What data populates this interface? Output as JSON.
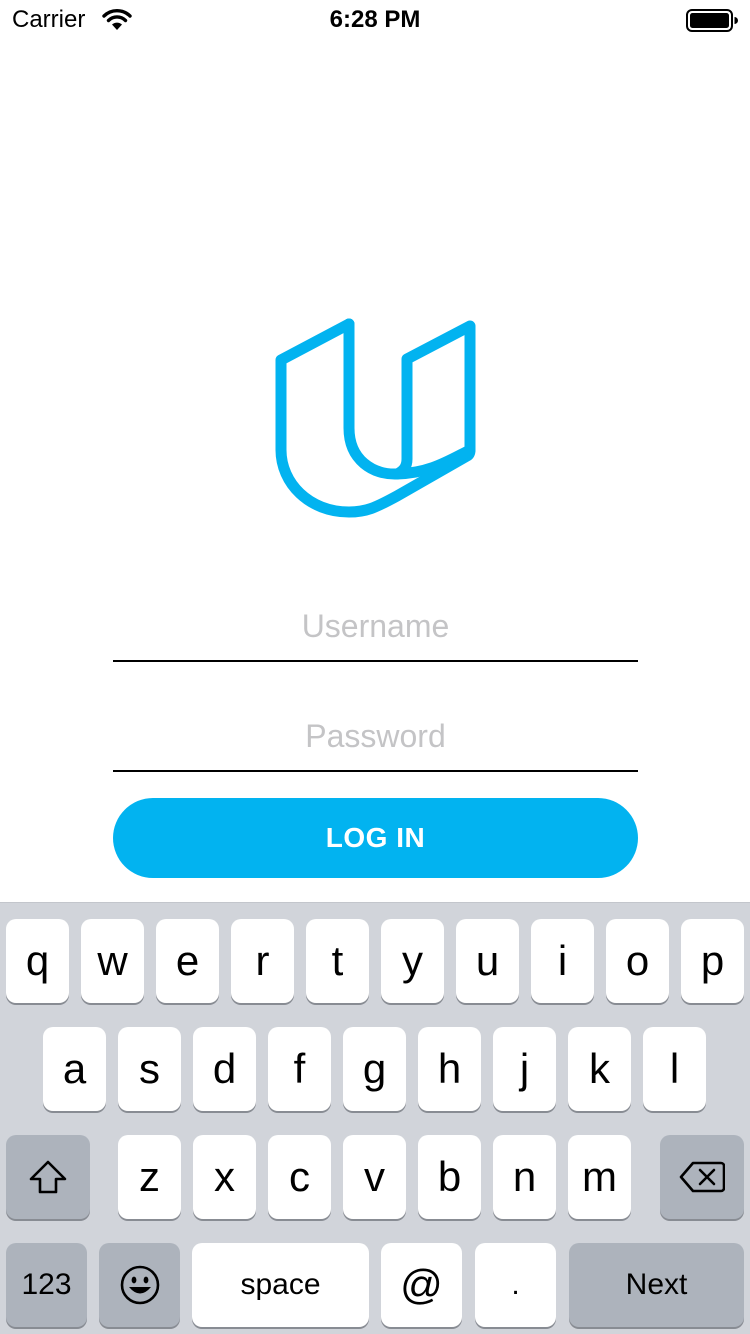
{
  "status_bar": {
    "carrier": "Carrier",
    "time": "6:28 PM",
    "wifi_icon": "wifi-icon",
    "battery_icon": "battery-icon"
  },
  "logo": {
    "icon": "udacity-logo",
    "color": "#02b3f0"
  },
  "form": {
    "username": {
      "value": "",
      "placeholder": "Username"
    },
    "password": {
      "value": "",
      "placeholder": "Password"
    },
    "login_label": "LOG IN",
    "accent_color": "#02b3f0"
  },
  "keyboard": {
    "row1": [
      "q",
      "w",
      "e",
      "r",
      "t",
      "y",
      "u",
      "i",
      "o",
      "p"
    ],
    "row2": [
      "a",
      "s",
      "d",
      "f",
      "g",
      "h",
      "j",
      "k",
      "l"
    ],
    "row3": [
      "z",
      "x",
      "c",
      "v",
      "b",
      "n",
      "m"
    ],
    "shift_icon": "shift-icon",
    "delete_icon": "delete-icon",
    "emoji_icon": "emoji-icon",
    "numbers_label": "123",
    "space_label": "space",
    "at_label": "@",
    "dot_label": ".",
    "next_label": "Next"
  }
}
